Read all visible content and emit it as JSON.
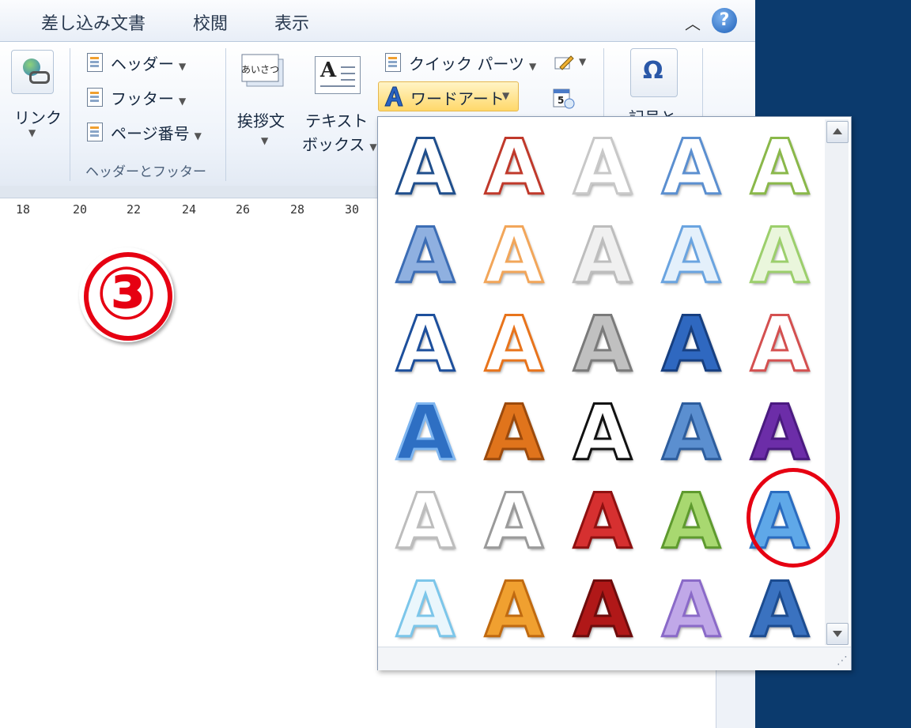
{
  "tabs": [
    {
      "label": "差し込み文書"
    },
    {
      "label": "校閲"
    },
    {
      "label": "表示"
    }
  ],
  "help": {
    "label": "?"
  },
  "ribbon": {
    "link": {
      "label": "リンク"
    },
    "header_footer": {
      "header": "ヘッダー",
      "footer": "フッター",
      "page_number": "ページ番号",
      "group_label": "ヘッダーとフッター"
    },
    "greeting": {
      "label": "挨拶文",
      "icon_text": "あいさつ"
    },
    "textbox": {
      "label_line1": "テキスト",
      "label_line2": "ボックス",
      "icon_text": "A"
    },
    "quick_parts": {
      "label": "クイック パーツ"
    },
    "wordart": {
      "label": "ワードアート"
    },
    "symbol": {
      "label": "記号と",
      "icon_text": "Ω"
    }
  },
  "ruler": {
    "ticks": [
      "18",
      "20",
      "22",
      "24",
      "26",
      "28",
      "30"
    ]
  },
  "step_marker": {
    "label": "③"
  },
  "gallery": {
    "glyph_char": "A",
    "styles": [
      [
        "#ffffff",
        "#1f4e8c"
      ],
      [
        "#ffffff",
        "#c0392b"
      ],
      [
        "#ffffff",
        "#c8c8c8"
      ],
      [
        "#ffffff",
        "#5b8fd0"
      ],
      [
        "#ffffff",
        "#8ab84a"
      ],
      [
        "#8fb0e0",
        "#3c6db5"
      ],
      [
        "#ffffff",
        "#f2a65a"
      ],
      [
        "#f0f0f0",
        "#bdbdbd"
      ],
      [
        "#e4f0fb",
        "#6aa4e0"
      ],
      [
        "#eaf6dc",
        "#9ccf6c"
      ],
      [
        "#ffffff",
        "#1d4f9c"
      ],
      [
        "#ffffff",
        "#e8741c"
      ],
      [
        "#c0c0c0",
        "#7a7a7a"
      ],
      [
        "#2f68c0",
        "#173f80"
      ],
      [
        "#ffffff",
        "#d45050"
      ],
      [
        "#2e6fc3",
        "#7fb6f0"
      ],
      [
        "#e0741c",
        "#9c4a0c"
      ],
      [
        "#ffffff",
        "#111111"
      ],
      [
        "#5b8fd0",
        "#2d5d9d"
      ],
      [
        "#6c2da8",
        "#4a1a80"
      ],
      [
        "#ffffff",
        "#bdbdbd"
      ],
      [
        "#ffffff",
        "#9a9a9a"
      ],
      [
        "#d63030",
        "#8f1010"
      ],
      [
        "#a8d870",
        "#5e9a2e"
      ],
      [
        "#5fa8e8",
        "#2a6cc0"
      ],
      [
        "#eaf6fc",
        "#7cc6ea"
      ],
      [
        "#f0a030",
        "#c06a10"
      ],
      [
        "#b01818",
        "#6e0c0c"
      ],
      [
        "#c0a8e8",
        "#8a6ac8"
      ],
      [
        "#3a72c0",
        "#1c4c90"
      ]
    ]
  }
}
